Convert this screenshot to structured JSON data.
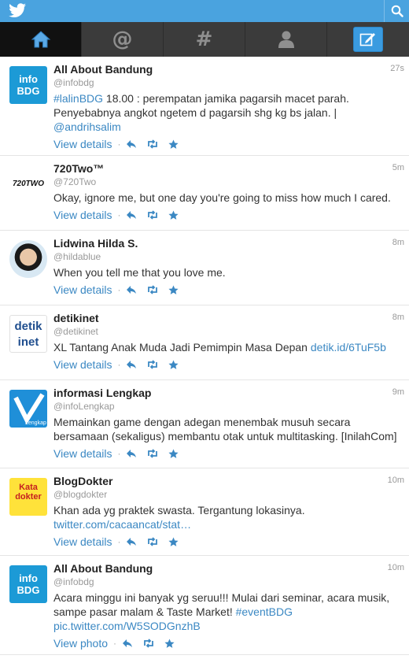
{
  "app": {
    "logo_icon": "twitter-bird-icon",
    "search_icon": "search-icon",
    "brand_color": "#4aa3df",
    "link_color": "#3b88c3"
  },
  "nav": {
    "tabs": [
      {
        "id": "home",
        "icon": "home-icon",
        "glyph": ""
      },
      {
        "id": "connect",
        "icon": "at-icon",
        "glyph": "@"
      },
      {
        "id": "discover",
        "icon": "hash-icon",
        "glyph": "#"
      },
      {
        "id": "me",
        "icon": "person-icon",
        "glyph": ""
      }
    ],
    "compose_icon": "compose-icon"
  },
  "tweets": [
    {
      "name": "All About Bandung",
      "handle": "@infobdg",
      "time": "27s",
      "text_parts": [
        "#lalinBDG",
        " 18.00 : perempatan jamika pagarsih macet parah. Penyebabnya angkot ngetem d pagarsih shg kg bs jalan. | ",
        "@andrihsalim"
      ],
      "action": "View details",
      "avatar_text": "info BDG"
    },
    {
      "name": "720Two™",
      "handle": "@720Two",
      "time": "5m",
      "text": "Okay, ignore me, but one day you're going to miss how much I cared.",
      "action": "View details",
      "avatar_text": "720TWO"
    },
    {
      "name": "Lidwina Hilda S.",
      "handle": "@hildablue",
      "time": "8m",
      "text": "When you tell me that you love me.",
      "action": "View details"
    },
    {
      "name": "detikinet",
      "handle": "@detikinet",
      "time": "8m",
      "text_parts": [
        "XL Tantang Anak Muda Jadi Pemimpin Masa Depan ",
        "detik.id/6TuF5b"
      ],
      "action": "View details",
      "avatar_text": "detik inet"
    },
    {
      "name": "informasi Lengkap",
      "handle": "@infoLengkap",
      "time": "9m",
      "text": "Memainkan game dengan adegan menembak musuh secara bersamaan (sekaligus) membantu otak untuk multitasking. [InilahCom]",
      "action": "View details",
      "avatar_text": "Lengkap"
    },
    {
      "name": "BlogDokter",
      "handle": "@blogdokter",
      "time": "10m",
      "text_parts": [
        "Khan ada yg praktek swasta. Tergantung lokasinya. ",
        "twitter.com/cacaancat/stat…"
      ],
      "action": "View details",
      "avatar_text": "Kata dokter"
    },
    {
      "name": "All About Bandung",
      "handle": "@infobdg",
      "time": "10m",
      "text_parts": [
        "Acara minggu ini banyak yg seruu!!! Mulai dari seminar, acara musik, sampe pasar malam & Taste Market! ",
        "#eventBDG",
        " ",
        "pic.twitter.com/W5SODGnzhB"
      ],
      "action": "View photo",
      "avatar_text": "info BDG"
    }
  ]
}
